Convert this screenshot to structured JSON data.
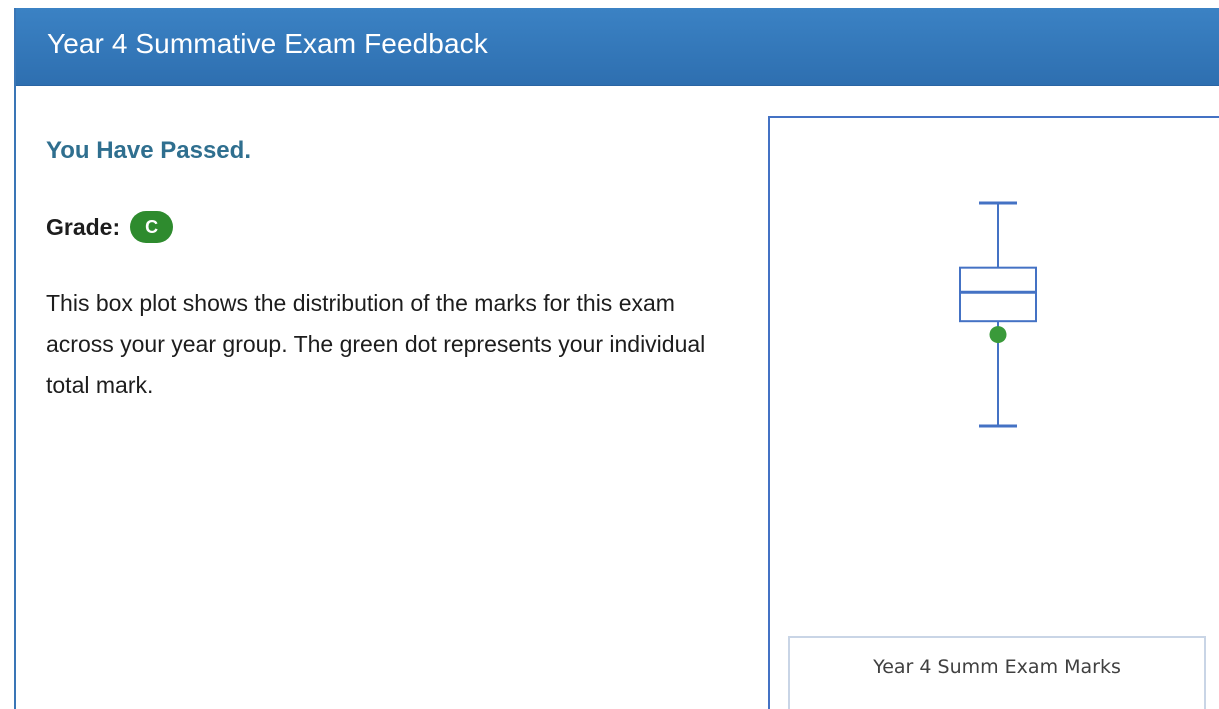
{
  "header": {
    "title": "Year 4 Summative Exam Feedback"
  },
  "result": {
    "heading": "You Have Passed.",
    "grade_label": "Grade:",
    "grade_value": "C"
  },
  "description": "This box plot shows the distribution of the marks for this exam across your year group. The green dot represents your individual total mark.",
  "colors": {
    "header_bg": "#3b82c4",
    "heading_text": "#2f6f8f",
    "grade_badge": "#2e8b2e",
    "box_stroke": "#4472c4",
    "student_dot": "#3a9a3a"
  },
  "chart_data": {
    "type": "box",
    "series_label": "Year 4 Summ Exam Marks",
    "box": {
      "whisker_high": 100,
      "q3": 71,
      "median": 60,
      "q1": 47,
      "whisker_low": 0
    },
    "student_mark": 41,
    "student_marker_color": "#3a9a3a",
    "ylim": [
      0,
      100
    ],
    "grid": false,
    "axis_ticks_visible": false
  }
}
